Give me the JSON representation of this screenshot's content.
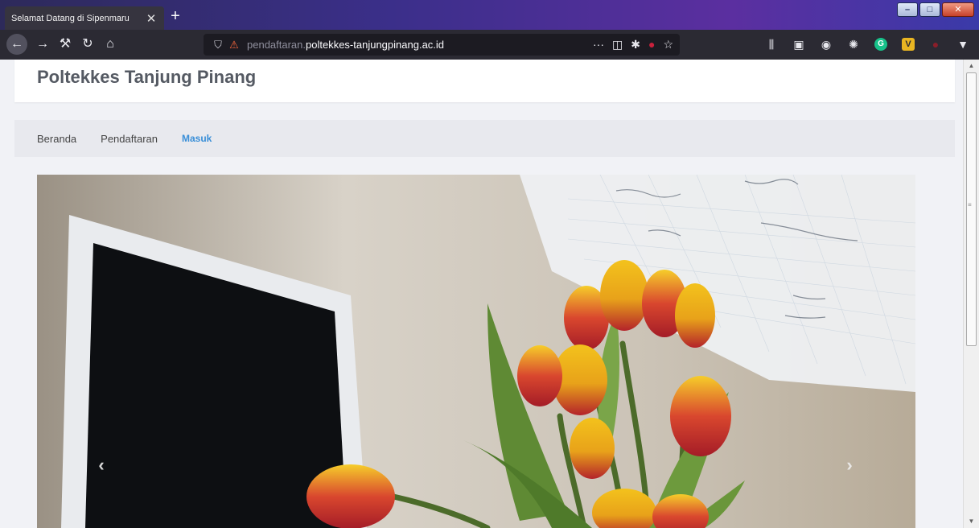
{
  "browser": {
    "tab_title": "Selamat Datang di Sipenmaru",
    "tab_close": "✕",
    "new_tab": "+",
    "url_subdomain": "pendaftaran.",
    "url_domain": "poltekkes-tanjungpinang.ac.id",
    "url_actions": "···"
  },
  "site": {
    "title": "Poltekkes Tanjung Pinang"
  },
  "menu": {
    "items": [
      {
        "label": "Beranda",
        "active": false
      },
      {
        "label": "Pendaftaran",
        "active": false
      },
      {
        "label": "Masuk",
        "active": true
      }
    ]
  },
  "slider": {
    "prev_label": "‹",
    "next_label": "›",
    "image_subject": "yellow-red tulips in front of laptop and handwritten notes"
  },
  "colors": {
    "accent": "#3a8fd8",
    "title_text": "#555a63",
    "page_bg": "#f1f2f6",
    "chrome_bg": "#2b2a33"
  }
}
